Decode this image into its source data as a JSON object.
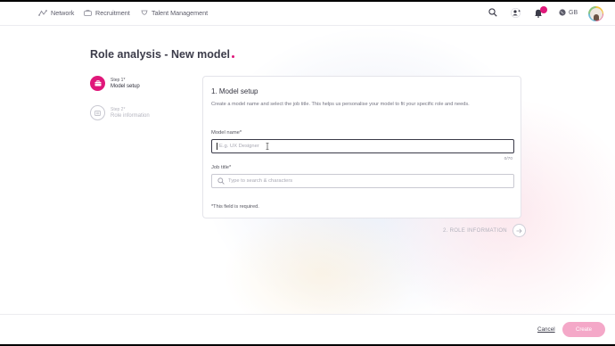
{
  "header": {
    "nav": [
      {
        "label": "Network",
        "icon": "network-icon"
      },
      {
        "label": "Recruitment",
        "icon": "recruitment-icon"
      },
      {
        "label": "Talent Management",
        "icon": "talent-management-icon"
      }
    ],
    "icons": [
      "search-icon",
      "add-user-icon",
      "bell-icon",
      "globe-icon",
      "avatar"
    ],
    "language": "GB"
  },
  "page": {
    "title": "Role analysis - New model"
  },
  "steps": [
    {
      "number": "Step 1*",
      "name": "Model setup",
      "state": "active",
      "icon": "briefcase-icon"
    },
    {
      "number": "Step 2*",
      "name": "Role information",
      "state": "inactive",
      "icon": "list-icon"
    }
  ],
  "form": {
    "title": "1. Model setup",
    "description": "Create a model name and select the job title. This helps us personalise your model to fit your specific role and needs.",
    "model_name": {
      "label": "Model name*",
      "placeholder": "E.g. UX Designer",
      "counter": "0/70"
    },
    "job_title": {
      "label": "Job title*",
      "placeholder": "Type to search & characters"
    },
    "required_note": "*This field is required."
  },
  "next": {
    "label": "2. ROLE INFORMATION"
  },
  "footer": {
    "cancel_label": "Cancel",
    "create_label": "Create"
  },
  "colors": {
    "accent": "#e0187a",
    "create_button": "#f4a8c8",
    "text": "#3a3a48"
  }
}
